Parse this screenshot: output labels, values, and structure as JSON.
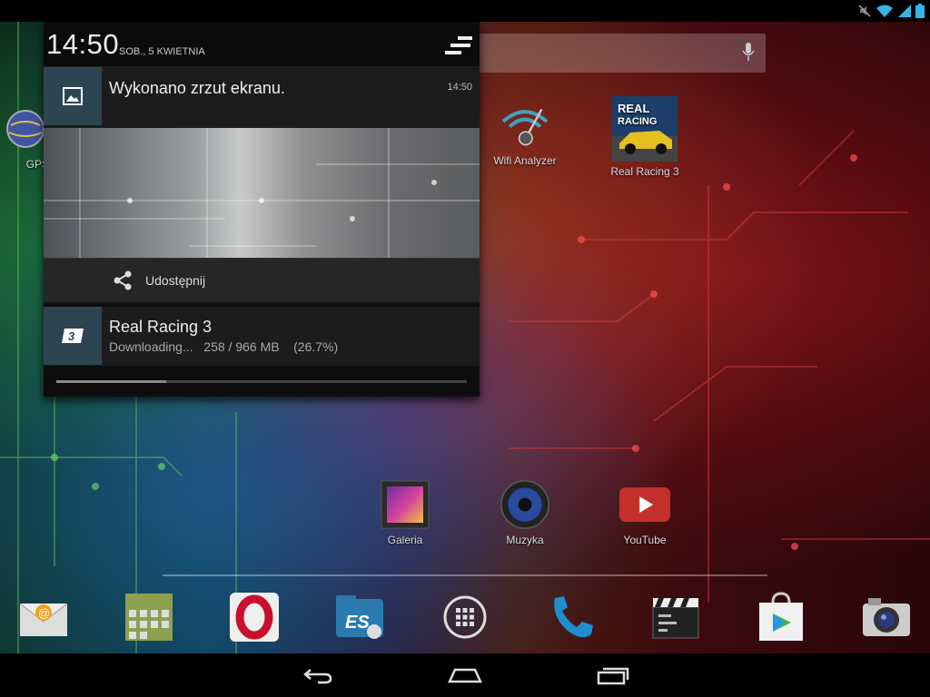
{
  "notifications_panel": {
    "clock": "14:50",
    "date": "SOB., 5 KWIETNIA",
    "screenshot": {
      "title": "Wykonano zrzut ekranu.",
      "time": "14:50",
      "action_label": "Udostępnij"
    },
    "download": {
      "title": "Real Racing 3",
      "status": "Downloading...",
      "size": "258 / 966 MB",
      "percent_text": "(26.7%)",
      "progress": 0.267
    }
  },
  "home": {
    "left_partial_app_label": "GPS",
    "apps": [
      {
        "name": "wifi-analyzer",
        "label": "Wifi Analyzer"
      },
      {
        "name": "real-racing-3",
        "label": "Real Racing 3"
      },
      {
        "name": "galeria",
        "label": "Galeria"
      },
      {
        "name": "muzyka",
        "label": "Muzyka"
      },
      {
        "name": "youtube",
        "label": "YouTube"
      }
    ]
  },
  "dock": [
    "email-icon",
    "calculator-icon",
    "opera-icon",
    "es-file-explorer-icon",
    "app-drawer-icon",
    "phone-icon",
    "movie-studio-icon",
    "play-store-icon",
    "camera-icon"
  ],
  "colors": {
    "accent_blue": "#33b5e5",
    "notif_icon_bg": "#2d4551",
    "youtube_red": "#c4302b"
  }
}
